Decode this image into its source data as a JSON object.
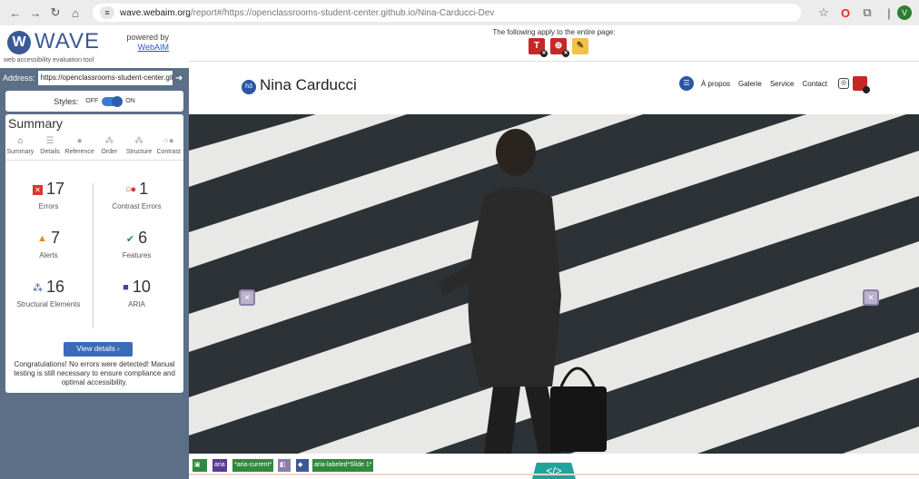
{
  "browser": {
    "url_domain": "wave.webaim.org",
    "url_rest": "/report#/https://openclassrooms-student-center.github.io/Nina-Carducci-Dev",
    "profile_initial": "V"
  },
  "wave": {
    "logo_text": "WAVE",
    "tagline": "web accessibility evaluation tool",
    "powered_by": "powered by",
    "powered_link": "WebAIM",
    "address_label": "Address:",
    "address_value": "https://openclassrooms-student-center.gith",
    "styles_label": "Styles:",
    "styles_off": "OFF",
    "styles_on": "ON",
    "summary_title": "Summary",
    "tabs": [
      {
        "label": "Summary",
        "icon": "home-icon"
      },
      {
        "label": "Details",
        "icon": "list-icon"
      },
      {
        "label": "Reference",
        "icon": "info-icon"
      },
      {
        "label": "Order",
        "icon": "order-icon"
      },
      {
        "label": "Structure",
        "icon": "structure-icon"
      },
      {
        "label": "Contrast",
        "icon": "contrast-icon"
      }
    ],
    "stats": {
      "errors": {
        "value": "17",
        "label": "Errors"
      },
      "contrast": {
        "value": "1",
        "label": "Contrast Errors"
      },
      "alerts": {
        "value": "7",
        "label": "Alerts"
      },
      "features": {
        "value": "6",
        "label": "Features"
      },
      "structural": {
        "value": "16",
        "label": "Structural Elements"
      },
      "aria": {
        "value": "10",
        "label": "ARIA"
      }
    },
    "view_details": "View details ›",
    "congrats": "Congratulations! No errors were detected! Manual testing is still necessary to ensure compliance and optimal accessibility."
  },
  "page": {
    "apply_text": "The following apply to the entire page:",
    "site_name": "Nina Carducci",
    "h3_badge": "h3",
    "nav": [
      "À propos",
      "Galerie",
      "Service",
      "Contact"
    ],
    "bottom_labels": [
      "aria",
      "*aria-current*",
      "aria-labeled*Slide 1*"
    ]
  },
  "colors": {
    "sidebar_bg": "#5b6f86",
    "wave_blue": "#3a5a96",
    "error_red": "#c62828",
    "code_teal": "#22a39a"
  }
}
